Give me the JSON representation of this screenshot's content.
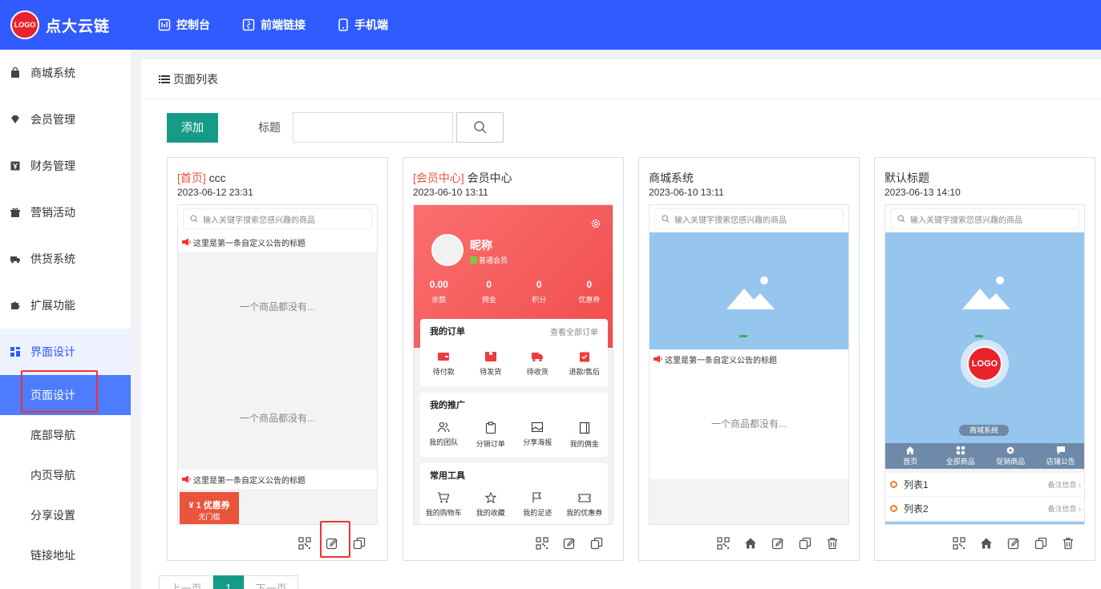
{
  "brand": {
    "logo_text": "LOGO",
    "name": "点大云链"
  },
  "topnav": [
    {
      "label": "控制台",
      "icon": "dashboard-icon"
    },
    {
      "label": "前端链接",
      "icon": "link-icon"
    },
    {
      "label": "手机端",
      "icon": "mobile-icon"
    }
  ],
  "sidebar": {
    "groups": [
      {
        "label": "商城系统",
        "icon": "shop-bag-icon"
      },
      {
        "label": "会员管理",
        "icon": "diamond-icon"
      },
      {
        "label": "财务管理",
        "icon": "yen-icon"
      },
      {
        "label": "营销活动",
        "icon": "gift-icon"
      },
      {
        "label": "供货系统",
        "icon": "truck-icon"
      },
      {
        "label": "扩展功能",
        "icon": "puzzle-icon"
      },
      {
        "label": "界面设计",
        "icon": "layout-icon"
      }
    ],
    "subitems": [
      {
        "label": "页面设计"
      },
      {
        "label": "底部导航"
      },
      {
        "label": "内页导航"
      },
      {
        "label": "分享设置"
      },
      {
        "label": "链接地址"
      }
    ]
  },
  "panel": {
    "title": "页面列表"
  },
  "toolbar": {
    "add_label": "添加",
    "title_label": "标题",
    "title_value": "",
    "title_placeholder": ""
  },
  "cards": [
    {
      "tag": "[首页]",
      "title": "ccc",
      "date": "2023-06-12 23:31"
    },
    {
      "tag": "[会员中心]",
      "title": "会员中心",
      "date": "2023-06-10 13:11"
    },
    {
      "tag": "",
      "title": "商城系统",
      "date": "2023-06-10 13:11"
    },
    {
      "tag": "",
      "title": "默认标题",
      "date": "2023-06-13 14:10"
    }
  ],
  "preview": {
    "search_placeholder": "输入关键字搜索您感兴趣的商品",
    "notice": "这里是第一条自定义公告的标题",
    "empty": "一个商品都没有...",
    "coupon_amount": "¥ 1 优惠券",
    "coupon_sub": "无门槛"
  },
  "member": {
    "nickname": "昵称",
    "level": "普通会员",
    "stats": [
      {
        "v": "0.00",
        "k": "余额"
      },
      {
        "v": "0",
        "k": "佣金"
      },
      {
        "v": "0",
        "k": "积分"
      },
      {
        "v": "0",
        "k": "优惠券"
      }
    ],
    "orders": {
      "title": "我的订单",
      "more": "查看全部订单",
      "items": [
        "待付款",
        "待发货",
        "待收货",
        "退款/售后"
      ]
    },
    "promo": {
      "title": "我的推广",
      "items": [
        "我的团队",
        "分销订单",
        "分享海报",
        "我的佣金"
      ]
    },
    "tools": {
      "title": "常用工具",
      "items": [
        "我的购物车",
        "我的收藏",
        "我的足迹",
        "我的优惠券"
      ]
    }
  },
  "default_page": {
    "logo_text": "LOGO",
    "shop_tag": "商城系统",
    "nav": [
      "首页",
      "全部商品",
      "促销商品",
      "店铺公告"
    ],
    "list": [
      {
        "label": "列表1",
        "remark": "备注信息"
      },
      {
        "label": "列表2",
        "remark": "备注信息"
      }
    ]
  },
  "pager": {
    "prev": "上一页",
    "current": "1",
    "next": "下一页"
  },
  "colors": {
    "primary": "#2f5bff",
    "accent": "#169c86",
    "highlight": "#ee3333"
  }
}
